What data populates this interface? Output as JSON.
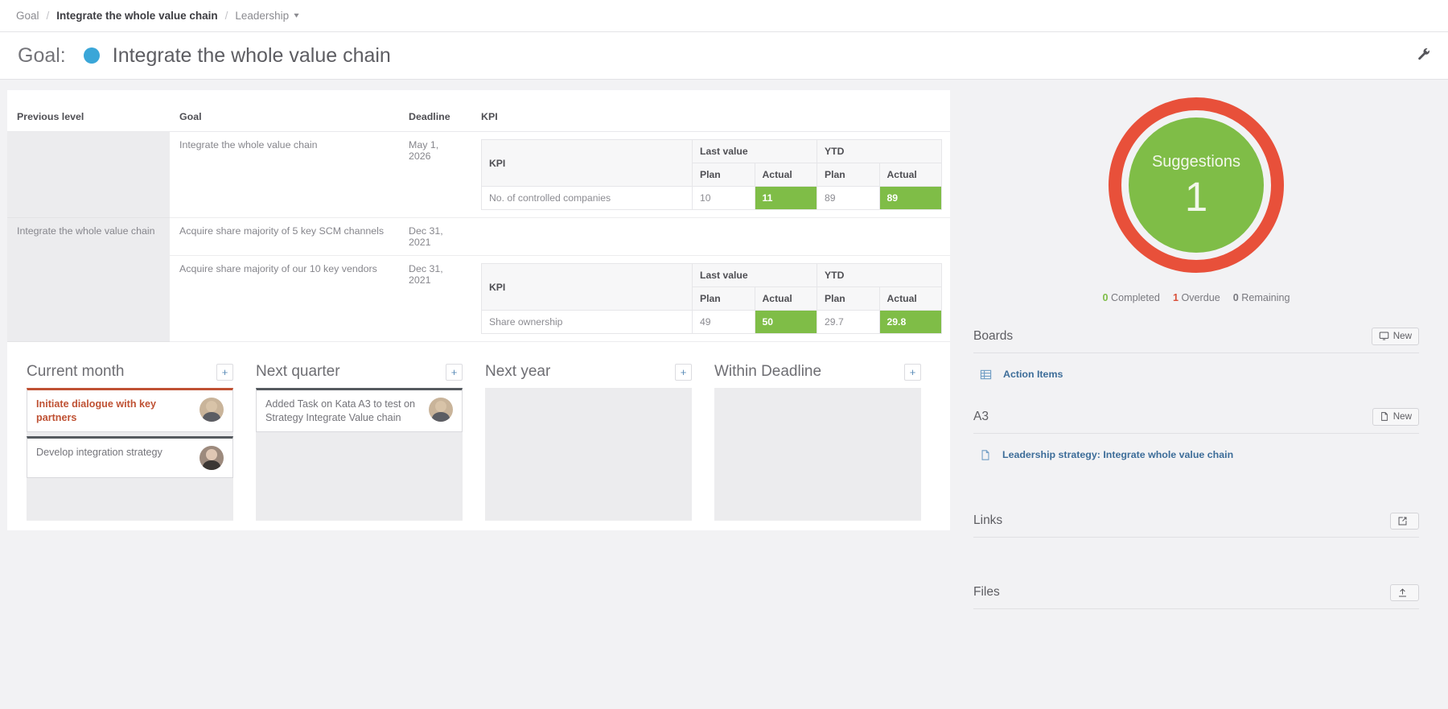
{
  "breadcrumb": {
    "items": [
      {
        "label": "Goal",
        "strong": false
      },
      {
        "label": "Integrate the whole value chain",
        "strong": true
      },
      {
        "label": "Leadership",
        "strong": false
      }
    ],
    "separator": "/",
    "caret": "⌄"
  },
  "header": {
    "label": "Goal:",
    "title": "Integrate the whole value chain",
    "status_color": "#3aa6d8",
    "tools_icon": "wrench-icon"
  },
  "goals_table": {
    "headers": [
      "Previous level",
      "Goal",
      "Deadline",
      "KPI"
    ],
    "rows": [
      {
        "previous_level": "",
        "goal": "Integrate the whole value chain",
        "deadline": "May 1, 2026",
        "kpi_table": {
          "group_headers": [
            "KPI",
            "Last value",
            "YTD"
          ],
          "sub_headers": [
            "Plan",
            "Actual",
            "Plan",
            "Actual"
          ],
          "rows": [
            {
              "name": "No. of controlled companies",
              "last_plan": "10",
              "last_actual": "11",
              "ytd_plan": "89",
              "ytd_actual": "89"
            }
          ]
        }
      },
      {
        "previous_level": "Integrate the whole value chain",
        "goal": "Acquire share majority of 5 key SCM channels",
        "deadline": "Dec 31, 2021",
        "kpi_table": null
      },
      {
        "previous_level": "",
        "goal": "Acquire share majority of our 10 key vendors",
        "deadline": "Dec 31, 2021",
        "kpi_table": {
          "group_headers": [
            "KPI",
            "Last value",
            "YTD"
          ],
          "sub_headers": [
            "Plan",
            "Actual",
            "Plan",
            "Actual"
          ],
          "rows": [
            {
              "name": "Share ownership",
              "last_plan": "49",
              "last_actual": "50",
              "ytd_plan": "29.7",
              "ytd_actual": "29.8"
            }
          ]
        }
      }
    ]
  },
  "kanban": {
    "add_label": "+",
    "columns": [
      {
        "title": "Current month",
        "cards": [
          {
            "text": "Initiate dialogue with key partners",
            "overdue": true,
            "avatar": "avatar-male"
          },
          {
            "text": "Develop integration strategy",
            "overdue": false,
            "avatar": "avatar-female"
          }
        ]
      },
      {
        "title": "Next quarter",
        "cards": [
          {
            "text": "Added Task on Kata A3 to test on Strategy Integrate Value chain",
            "overdue": false,
            "avatar": "avatar-male"
          }
        ]
      },
      {
        "title": "Next year",
        "cards": []
      },
      {
        "title": "Within Deadline",
        "cards": []
      }
    ]
  },
  "sidebar": {
    "gauge": {
      "label": "Suggestions",
      "value": "1",
      "ring_color": "#e8503a",
      "fill_color": "#7fbd47"
    },
    "legend": [
      {
        "count": "0",
        "label": "Completed",
        "color": "#7fbd47"
      },
      {
        "count": "1",
        "label": "Overdue",
        "color": "#d9503a"
      },
      {
        "count": "0",
        "label": "Remaining",
        "color": "#79797f"
      }
    ],
    "sections": [
      {
        "title": "Boards",
        "button_label": "New",
        "button_icon": "monitor-icon",
        "items": [
          {
            "label": "Action Items",
            "icon": "table-icon"
          }
        ]
      },
      {
        "title": "A3",
        "button_label": "New",
        "button_icon": "file-icon",
        "items": [
          {
            "label": "Leadership strategy: Integrate whole value chain",
            "icon": "document-icon"
          }
        ]
      },
      {
        "title": "Links",
        "button_label": "",
        "button_icon": "external-link-icon",
        "items": []
      },
      {
        "title": "Files",
        "button_label": "",
        "button_icon": "upload-icon",
        "items": []
      }
    ]
  }
}
